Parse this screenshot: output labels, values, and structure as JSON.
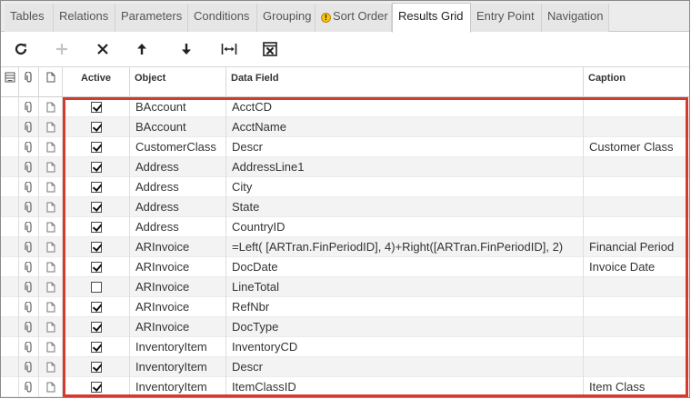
{
  "tabs": [
    {
      "label": "Tables",
      "active": false
    },
    {
      "label": "Relations",
      "active": false
    },
    {
      "label": "Parameters",
      "active": false
    },
    {
      "label": "Conditions",
      "active": false
    },
    {
      "label": "Grouping",
      "active": false
    },
    {
      "label": "Sort Order",
      "active": false,
      "icon": "warning-icon"
    },
    {
      "label": "Results Grid",
      "active": true
    },
    {
      "label": "Entry Point",
      "active": false
    },
    {
      "label": "Navigation",
      "active": false
    }
  ],
  "toolbar": {
    "buttons": [
      {
        "name": "refresh-icon"
      },
      {
        "name": "add-icon"
      },
      {
        "name": "delete-icon"
      },
      {
        "name": "arrow-up-icon"
      },
      {
        "name": "arrow-down-icon"
      },
      {
        "name": "fit-width-icon"
      },
      {
        "name": "export-excel-icon"
      }
    ]
  },
  "columns": {
    "active": "Active",
    "object": "Object",
    "data_field": "Data Field",
    "caption": "Caption"
  },
  "rows": [
    {
      "active": true,
      "object": "BAccount",
      "data_field": "AcctCD",
      "caption": ""
    },
    {
      "active": true,
      "object": "BAccount",
      "data_field": "AcctName",
      "caption": ""
    },
    {
      "active": true,
      "object": "CustomerClass",
      "data_field": "Descr",
      "caption": "Customer Class"
    },
    {
      "active": true,
      "object": "Address",
      "data_field": "AddressLine1",
      "caption": ""
    },
    {
      "active": true,
      "object": "Address",
      "data_field": "City",
      "caption": ""
    },
    {
      "active": true,
      "object": "Address",
      "data_field": "State",
      "caption": ""
    },
    {
      "active": true,
      "object": "Address",
      "data_field": "CountryID",
      "caption": ""
    },
    {
      "active": true,
      "object": "ARInvoice",
      "data_field": "=Left( [ARTran.FinPeriodID], 4)+Right([ARTran.FinPeriodID], 2)",
      "caption": "Financial Period"
    },
    {
      "active": true,
      "object": "ARInvoice",
      "data_field": "DocDate",
      "caption": "Invoice Date"
    },
    {
      "active": false,
      "object": "ARInvoice",
      "data_field": "LineTotal",
      "caption": ""
    },
    {
      "active": true,
      "object": "ARInvoice",
      "data_field": "RefNbr",
      "caption": ""
    },
    {
      "active": true,
      "object": "ARInvoice",
      "data_field": "DocType",
      "caption": ""
    },
    {
      "active": true,
      "object": "InventoryItem",
      "data_field": "InventoryCD",
      "caption": ""
    },
    {
      "active": true,
      "object": "InventoryItem",
      "data_field": "Descr",
      "caption": ""
    },
    {
      "active": true,
      "object": "InventoryItem",
      "data_field": "ItemClassID",
      "caption": "Item Class"
    }
  ],
  "colors": {
    "highlight": "#d63a2e",
    "alt_row": "#f3f3f3"
  }
}
